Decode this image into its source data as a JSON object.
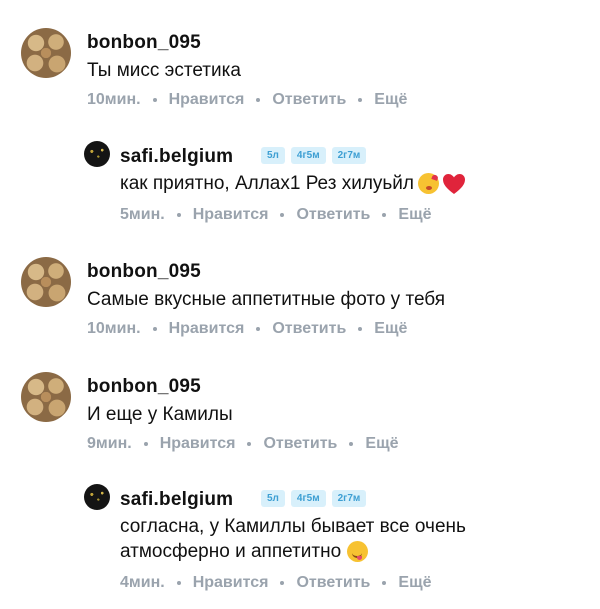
{
  "comments": [
    {
      "username": "bonbon_095",
      "text": "Ты мисс эстетика",
      "time": "10мин.",
      "like": "Нравится",
      "reply": "Ответить",
      "more": "Ещё"
    },
    {
      "username": "safi.belgium",
      "badges": [
        "5л",
        "4г5м",
        "2г7м"
      ],
      "text": "как приятно, Аллах1 Рез хилуьйл",
      "emojis": [
        "kissing-face-emoji",
        "red-heart-emoji"
      ],
      "time": "5мин.",
      "like": "Нравится",
      "reply": "Ответить",
      "more": "Ещё"
    },
    {
      "username": "bonbon_095",
      "text": "Самые вкусные аппетитные  фото у тебя",
      "time": "10мин.",
      "like": "Нравится",
      "reply": "Ответить",
      "more": "Ещё"
    },
    {
      "username": "bonbon_095",
      "text": "И еще у Камилы",
      "time": "9мин.",
      "like": "Нравится",
      "reply": "Ответить",
      "more": "Ещё"
    },
    {
      "username": "safi.belgium",
      "badges": [
        "5л",
        "4г5м",
        "2г7м"
      ],
      "text_line1": "согласна, у Камиллы бывает все очень",
      "text_line2": "атмосферно и аппетитно",
      "emojis": [
        "yum-face-emoji"
      ],
      "time": "4мин.",
      "like": "Нравится",
      "reply": "Ответить",
      "more": "Ещё"
    }
  ],
  "colors": {
    "meta": "#9aa3ad",
    "badge_bg": "#d8f0fb",
    "badge_text": "#3d9fd3",
    "heart": "#e0243b"
  }
}
